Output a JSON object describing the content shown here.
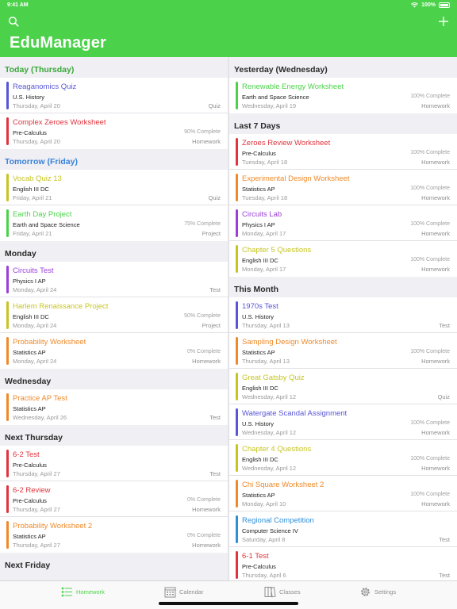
{
  "status": {
    "time": "9:41 AM",
    "battery": "100%"
  },
  "app": {
    "title": "EduManager"
  },
  "colors": {
    "green": "#4cd24a",
    "blue": "#3b82d8",
    "purple": "#9b3fd8",
    "indigo": "#5856d6",
    "red": "#e0343e",
    "orange": "#ef8a2a",
    "yellow": "#c7c524",
    "sky": "#2d8fd8"
  },
  "left_sections": [
    {
      "title": "Today (Thursday)",
      "style": "today",
      "items": [
        {
          "name": "Reaganomics Quiz",
          "class": "U.S. History",
          "date": "Thursday, April 20",
          "pct": "",
          "type": "Quiz",
          "color": "#5856d6"
        },
        {
          "name": "Complex Zeroes Worksheet",
          "class": "Pre-Calculus",
          "date": "Thursday, April 20",
          "pct": "90% Complete",
          "type": "Homework",
          "color": "#e0343e"
        }
      ]
    },
    {
      "title": "Tomorrow (Friday)",
      "style": "tomorrow",
      "items": [
        {
          "name": "Vocab Quiz 13",
          "class": "English III DC",
          "date": "Friday, April 21",
          "pct": "",
          "type": "Quiz",
          "color": "#c7c524"
        },
        {
          "name": "Earth Day Project",
          "class": "Earth and Space Science",
          "date": "Friday, April 21",
          "pct": "75% Complete",
          "type": "Project",
          "color": "#4cd24a"
        }
      ]
    },
    {
      "title": "Monday",
      "style": "",
      "items": [
        {
          "name": "Circuits Test",
          "class": "Physics I AP",
          "date": "Monday, April 24",
          "pct": "",
          "type": "Test",
          "color": "#9b3fd8"
        },
        {
          "name": "Harlem Renaissance Project",
          "class": "English III DC",
          "date": "Monday, April 24",
          "pct": "50% Complete",
          "type": "Project",
          "color": "#c7c524"
        },
        {
          "name": "Probability Worksheet",
          "class": "Statistics AP",
          "date": "Monday, April 24",
          "pct": "0% Complete",
          "type": "Homework",
          "color": "#ef8a2a"
        }
      ]
    },
    {
      "title": "Wednesday",
      "style": "",
      "items": [
        {
          "name": "Practice AP Test",
          "class": "Statistics AP",
          "date": "Wednesday, April 26",
          "pct": "",
          "type": "Test",
          "color": "#ef8a2a"
        }
      ]
    },
    {
      "title": "Next Thursday",
      "style": "",
      "items": [
        {
          "name": "6-2 Test",
          "class": "Pre-Calculus",
          "date": "Thursday, April 27",
          "pct": "",
          "type": "Test",
          "color": "#e0343e"
        },
        {
          "name": "6-2 Review",
          "class": "Pre-Calculus",
          "date": "Thursday, April 27",
          "pct": "0% Complete",
          "type": "Homework",
          "color": "#e0343e"
        },
        {
          "name": "Probability Worksheet 2",
          "class": "Statistics AP",
          "date": "Thursday, April 27",
          "pct": "0% Complete",
          "type": "Homework",
          "color": "#ef8a2a"
        }
      ]
    },
    {
      "title": "Next Friday",
      "style": "",
      "items": []
    }
  ],
  "right_sections": [
    {
      "title": "Yesterday (Wednesday)",
      "style": "",
      "items": [
        {
          "name": "Renewable Energy Worksheet",
          "class": "Earth and Space Science",
          "date": "Wednesday, April 19",
          "pct": "100% Complete",
          "type": "Homework",
          "color": "#4cd24a"
        }
      ]
    },
    {
      "title": "Last 7 Days",
      "style": "",
      "items": [
        {
          "name": "Zeroes Review Worksheet",
          "class": "Pre-Calculus",
          "date": "Tuesday, April 18",
          "pct": "100% Complete",
          "type": "Homework",
          "color": "#e0343e"
        },
        {
          "name": "Experimental Design Worksheet",
          "class": "Statistics AP",
          "date": "Tuesday, April 18",
          "pct": "100% Complete",
          "type": "Homework",
          "color": "#ef8a2a"
        },
        {
          "name": "Circuits Lab",
          "class": "Physics I AP",
          "date": "Monday, April 17",
          "pct": "100% Complete",
          "type": "Homework",
          "color": "#9b3fd8"
        },
        {
          "name": "Chapter 5 Questions",
          "class": "English III DC",
          "date": "Monday, April 17",
          "pct": "100% Complete",
          "type": "Homework",
          "color": "#c7c524"
        }
      ]
    },
    {
      "title": "This Month",
      "style": "",
      "items": [
        {
          "name": "1970s Test",
          "class": "U.S. History",
          "date": "Thursday, April 13",
          "pct": "",
          "type": "Test",
          "color": "#5856d6"
        },
        {
          "name": "Sampling Design Worksheet",
          "class": "Statistics AP",
          "date": "Thursday, April 13",
          "pct": "100% Complete",
          "type": "Homework",
          "color": "#ef8a2a"
        },
        {
          "name": "Great Gatsby Quiz",
          "class": "English III DC",
          "date": "Wednesday, April 12",
          "pct": "",
          "type": "Quiz",
          "color": "#c7c524"
        },
        {
          "name": "Watergate Scandal Assignment",
          "class": "U.S. History",
          "date": "Wednesday, April 12",
          "pct": "100% Complete",
          "type": "Homework",
          "color": "#5856d6"
        },
        {
          "name": "Chapter 4 Questions",
          "class": "English III DC",
          "date": "Wednesday, April 12",
          "pct": "100% Complete",
          "type": "Homework",
          "color": "#c7c524"
        },
        {
          "name": "Chi Square Worksheet 2",
          "class": "Statistics AP",
          "date": "Monday, April 10",
          "pct": "100% Complete",
          "type": "Homework",
          "color": "#ef8a2a"
        },
        {
          "name": "Regional Competition",
          "class": "Computer Science IV",
          "date": "Saturday, April 8",
          "pct": "",
          "type": "Test",
          "color": "#2d8fd8"
        },
        {
          "name": "6-1 Test",
          "class": "Pre-Calculus",
          "date": "Thursday, April 6",
          "pct": "",
          "type": "Test",
          "color": "#e0343e"
        }
      ]
    }
  ],
  "tabs": [
    {
      "label": "Homework",
      "icon": "list-icon",
      "active": true
    },
    {
      "label": "Calendar",
      "icon": "calendar-icon",
      "active": false
    },
    {
      "label": "Classes",
      "icon": "books-icon",
      "active": false
    },
    {
      "label": "Settings",
      "icon": "gear-icon",
      "active": false
    }
  ]
}
